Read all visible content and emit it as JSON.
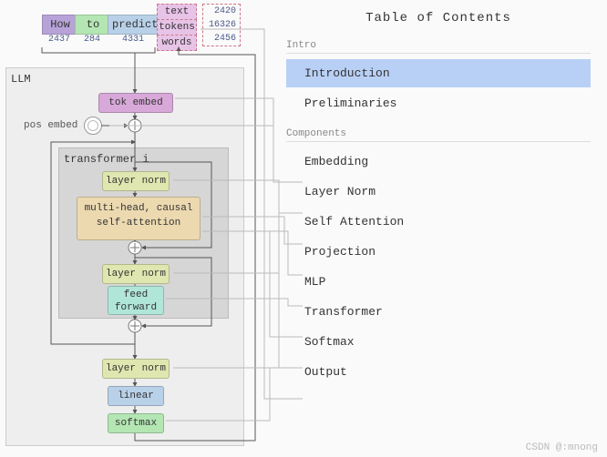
{
  "tokens": {
    "how": "How",
    "to": "to",
    "predict": "predict",
    "col": {
      "text": "text",
      "tokens": "tokens",
      "words": "words"
    },
    "ids": {
      "how": "2437",
      "to": "284",
      "predict": "4331"
    },
    "outs": {
      "text": "2420",
      "tokens": "16326",
      "words": "2456"
    }
  },
  "llm_label": "LLM",
  "pos_embed_label": "pos embed",
  "tx_label": "transformer i",
  "blocks": {
    "tok_embed": "tok embed",
    "ln": "layer norm",
    "attn1": "multi-head, causal",
    "attn2": "self-attention",
    "feed": "feed",
    "forward": "forward",
    "linear": "linear",
    "softmax": "softmax"
  },
  "toc": {
    "title": "Table of Contents",
    "sections": [
      {
        "label": "Intro",
        "items": [
          "Introduction",
          "Preliminaries"
        ]
      },
      {
        "label": "Components",
        "items": [
          "Embedding",
          "Layer Norm",
          "Self Attention",
          "Projection",
          "MLP",
          "Transformer",
          "Softmax",
          "Output"
        ]
      }
    ],
    "selected": "Introduction"
  },
  "watermark": "CSDN @:mnong"
}
